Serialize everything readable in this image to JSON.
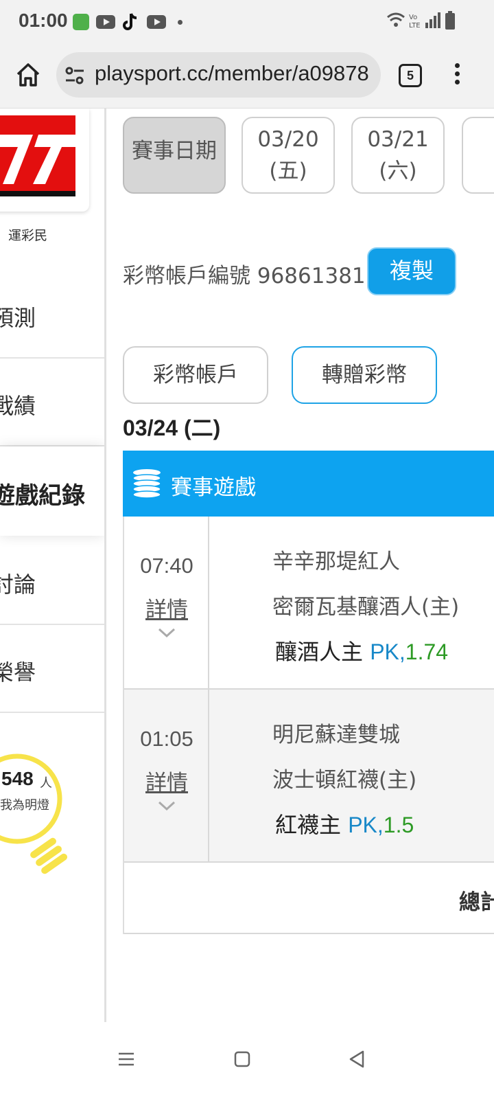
{
  "status_bar": {
    "time": "01:00",
    "icons": [
      "app-icon",
      "youtube-icon",
      "tiktok-icon",
      "youtube-icon",
      "dot-icon",
      "wifi-icon",
      "volte-icon",
      "signal-icon",
      "battery-icon"
    ]
  },
  "browser": {
    "url": "playsport.cc/member/a09878",
    "tab_count": "5"
  },
  "sidebar": {
    "brand": "運彩民",
    "items": [
      {
        "label": "預測"
      },
      {
        "label": "戰績"
      },
      {
        "label": "遊戲紀錄"
      },
      {
        "label": "討論"
      },
      {
        "label": "榮譽"
      }
    ],
    "bulb_count": "548",
    "bulb_unit": "人",
    "bulb_text": "我為明燈"
  },
  "main": {
    "date_label": "賽事日期",
    "dates": [
      {
        "date": "03/20",
        "weekday": "(五)"
      },
      {
        "date": "03/21",
        "weekday": "(六)"
      }
    ],
    "account_label": "彩幣帳戶編號 96861381",
    "copy_button": "複製",
    "account_button": "彩幣帳戶",
    "transfer_button": "轉贈彩幣",
    "day_heading": "03/24 (二)",
    "section_title": "賽事遊戲",
    "games": [
      {
        "time": "07:40",
        "detail": "詳情",
        "away": "辛辛那堤紅人",
        "home": "密爾瓦基釀酒人(主)",
        "pick": "釀酒人主 ",
        "pk": "PK,",
        "odds": "1.74"
      },
      {
        "time": "01:05",
        "detail": "詳情",
        "away": "明尼蘇達雙城",
        "home": "波士頓紅襪(主)",
        "pick": "紅襪主 ",
        "pk": "PK,",
        "odds": "1.5"
      }
    ],
    "total_label": "總計"
  },
  "colors": {
    "accent": "#0da3f0",
    "pk": "#1888c8",
    "odds": "#2d9a25",
    "logo": "#e30f0f"
  }
}
